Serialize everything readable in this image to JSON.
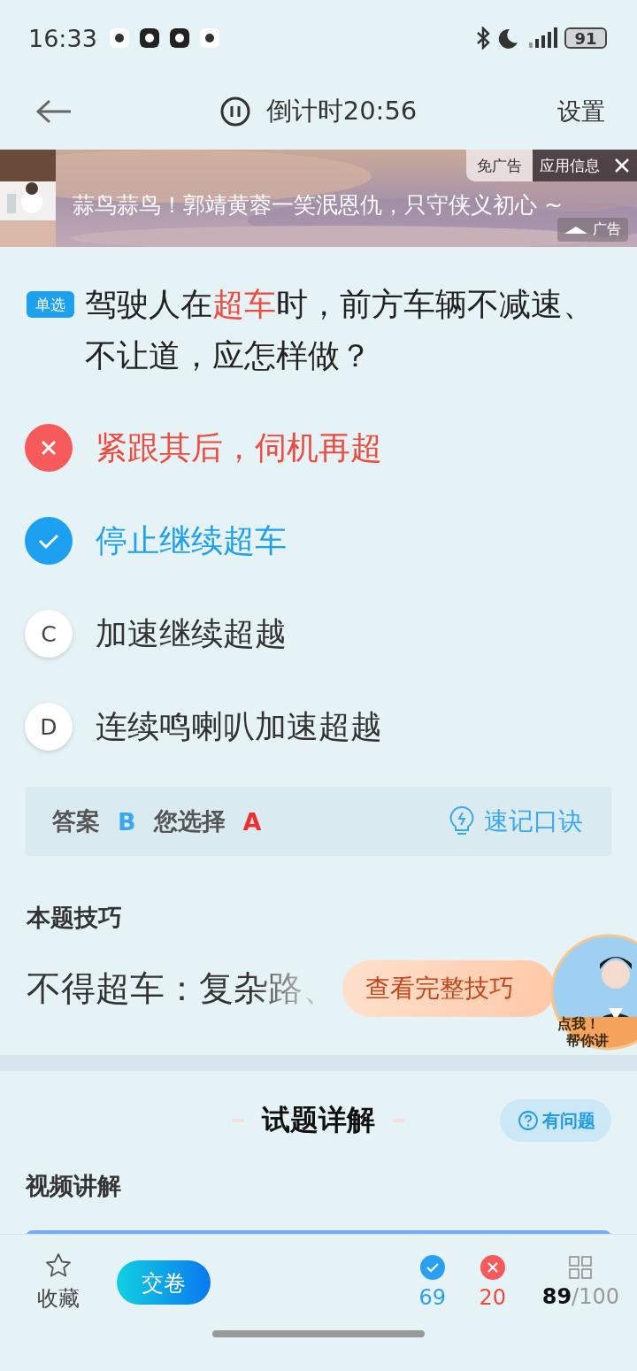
{
  "status_bar": {
    "time": "16:33",
    "battery": "91"
  },
  "header": {
    "timer": "倒计时20:56",
    "settings": "设置"
  },
  "ad": {
    "text": "蒜鸟蒜鸟！郭靖黄蓉一笑泯恩仇，只守侠义初心 ~",
    "remove_ad": "免广告",
    "app_info": "应用信息",
    "label": "广告"
  },
  "question": {
    "type_tag": "单选",
    "parts": [
      {
        "text": "驾驶人在",
        "highlight": false
      },
      {
        "text": "超车",
        "highlight": true
      },
      {
        "text": "时，前方车辆不减速、不让道，应怎样做？",
        "highlight": false
      }
    ]
  },
  "options": [
    {
      "kind": "wrong",
      "text": "紧跟其后，伺机再超"
    },
    {
      "kind": "correct",
      "text": "停止继续超车"
    },
    {
      "kind": "plain",
      "letter": "C",
      "text": "加速继续超越"
    },
    {
      "kind": "plain",
      "letter": "D",
      "text": "连续鸣喇叭加速超越"
    }
  ],
  "answer_bar": {
    "answer_label": "答案",
    "answer": "B",
    "choice_label": "您选择",
    "choice": "A",
    "tip_button": "速记口诀"
  },
  "skill": {
    "title": "本题技巧",
    "text": "不得超车：复杂路、",
    "button": "查看完整技巧",
    "badge_line_1": "点我！",
    "badge_line_2": "帮你讲"
  },
  "explain": {
    "title": "试题详解",
    "help_button": "有问题",
    "video_title": "视频讲解"
  },
  "bottom_bar": {
    "favorite": "收藏",
    "submit": "交卷",
    "correct_count": "69",
    "wrong_count": "20",
    "done": "89",
    "total": "/100"
  }
}
